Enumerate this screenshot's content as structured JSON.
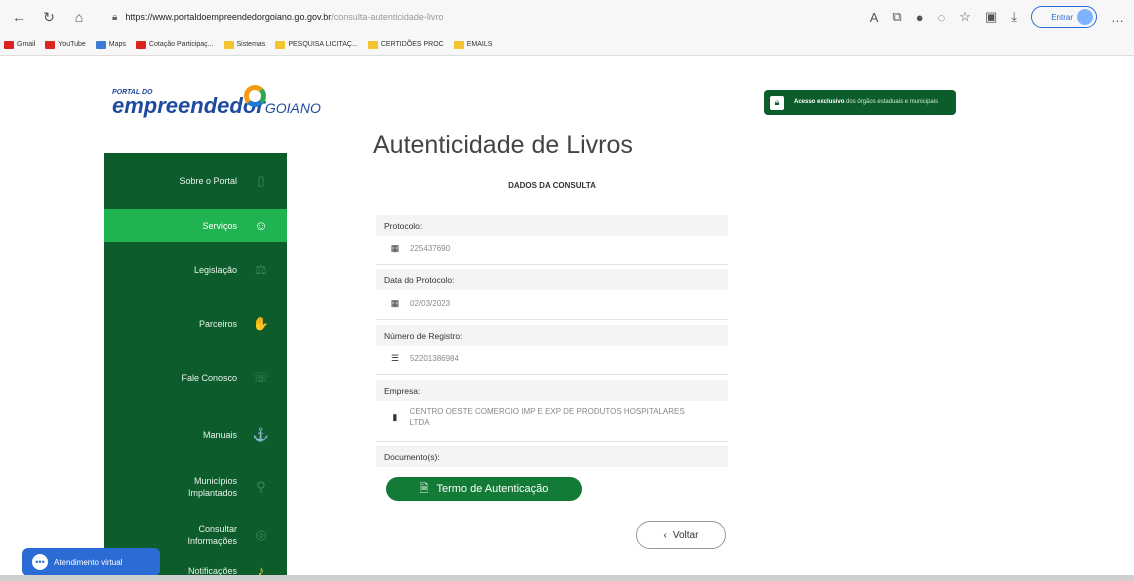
{
  "browser": {
    "url_domain": "https://www.portaldoempreendedorgoiano.go.gov.br",
    "url_path": "/consulta-autenticidade-livro",
    "profile_button": "Entrar",
    "bookmarks": [
      "Gmail",
      "YouTube",
      "Maps",
      "Cotação Participaç...",
      "Sistemas",
      "PESQUISA LICITAÇ...",
      "CERTIDÕES PROC",
      "EMAILS"
    ]
  },
  "logo": {
    "small": "PORTAL DO",
    "big": "empreendedor",
    "suffix": "GOIANO"
  },
  "sidebar": {
    "items": [
      {
        "label": "Sobre o Portal",
        "icon": "▯"
      },
      {
        "label": "Serviços",
        "icon": "☺"
      },
      {
        "label": "Legislação",
        "icon": "⚖"
      },
      {
        "label": "Parceiros",
        "icon": "✋"
      },
      {
        "label": "Fale Conosco",
        "icon": "☏"
      },
      {
        "label": "Manuais",
        "icon": "⚓"
      },
      {
        "label": "Municípios Implantados",
        "icon": "⚲"
      },
      {
        "label": "Consultar Informações",
        "icon": "◎"
      },
      {
        "label": "Notificações",
        "icon": "♪"
      }
    ]
  },
  "access_banner": {
    "text_bold": "Acesso exclusivo",
    "text_rest": "dos órgãos estaduais e municipais"
  },
  "chat": {
    "label": "Atendimento virtual"
  },
  "main": {
    "title": "Autenticidade de Livros",
    "subtitle": "DADOS DA CONSULTA",
    "fields": [
      {
        "label": "Protocolo:",
        "value": "225437690"
      },
      {
        "label": "Data do Protocolo:",
        "value": "02/03/2023"
      },
      {
        "label": "Número de Registro:",
        "value": "52201386984"
      },
      {
        "label": "Empresa:",
        "value": "CENTRO OESTE COMERCIO IMP E EXP DE PRODUTOS HOSPITALARES LTDA"
      }
    ],
    "documents_label": "Documento(s):",
    "document_button": "Termo de Autenticação",
    "back_button": "Voltar"
  }
}
